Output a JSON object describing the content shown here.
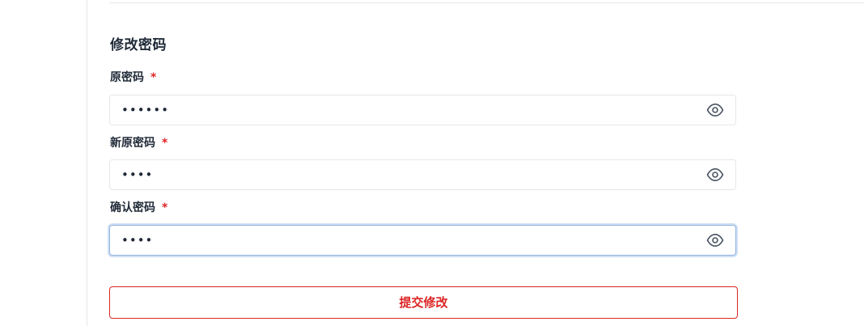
{
  "form": {
    "title": "修改密码",
    "required_mark": "*",
    "fields": [
      {
        "label": "原密码",
        "masked_value": "••••••",
        "icon": "eye-icon"
      },
      {
        "label": "新原密码",
        "masked_value": "••••",
        "icon": "eye-icon"
      },
      {
        "label": "确认密码",
        "masked_value": "••••",
        "icon": "eye-icon",
        "focused": true
      }
    ],
    "submit_label": "提交修改"
  },
  "colors": {
    "accent": "#dc2626",
    "border": "#e5e7eb",
    "focus_ring": "#cfe0f5",
    "text": "#1f2937"
  }
}
